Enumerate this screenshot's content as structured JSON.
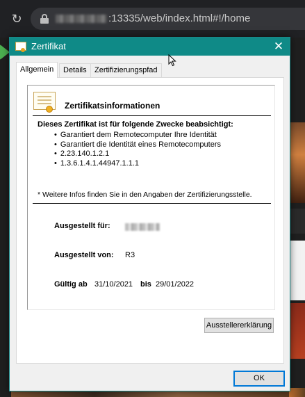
{
  "browser": {
    "url_suffix": ":13335/web/index.html#!/home"
  },
  "dialog": {
    "title": "Zertifikat",
    "close_label": "✕",
    "tabs": [
      {
        "label": "Allgemein",
        "active": true
      },
      {
        "label": "Details",
        "active": false
      },
      {
        "label": "Zertifizierungspfad",
        "active": false
      }
    ],
    "info": {
      "heading": "Zertifikatsinformationen",
      "purpose_title": "Dieses Zertifikat ist für folgende Zwecke beabsichtigt:",
      "purposes": [
        "Garantiert dem Remotecomputer Ihre Identität",
        "Garantiert die Identität eines Remotecomputers",
        "2.23.140.1.2.1",
        "1.3.6.1.4.1.44947.1.1.1"
      ],
      "note": "* Weitere Infos finden Sie in den Angaben der Zertifizierungsstelle.",
      "issued_to_label": "Ausgestellt für:",
      "issued_by_label": "Ausgestellt von:",
      "issued_by_value": "R3",
      "valid_from_label": "Gültig ab",
      "valid_from_value": "31/10/2021",
      "valid_to_label": "bis",
      "valid_to_value": "29/01/2022"
    },
    "issuer_statement_button": "Ausstellererklärung",
    "ok_button": "OK"
  },
  "colors": {
    "titlebar": "#0f8a87",
    "ok_border": "#0078d7"
  }
}
